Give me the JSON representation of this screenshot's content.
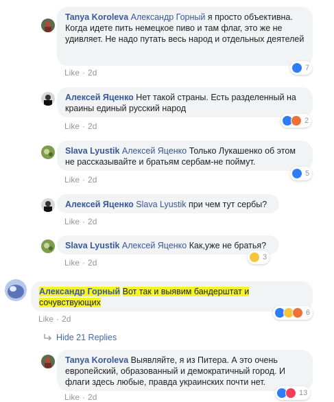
{
  "colors": {
    "link": "#385898",
    "bubble": "#f2f3f5",
    "meta": "#90949c",
    "highlight": "#f7f51f"
  },
  "comments": [
    {
      "author": "Tanya Koroleva",
      "mention": "Александр Горный",
      "text": "я просто объективна. Когда идете пить немецкое пиво и там флаг, это же не удивляет. Не надо путать весь народ и отдельных деятелей",
      "like": "Like",
      "time": "2d",
      "reaction_count": "7"
    },
    {
      "author": "Алексей Яценко",
      "mention": "",
      "text": "Нет такой страны. Есть разделенный на краины единый русский народ",
      "like": "Like",
      "time": "2d",
      "reaction_count": "2"
    },
    {
      "author": "Slava Lyustik",
      "mention": "Алексей Яценко",
      "text": "Только Лукашенко об этом не рассказывайте и братьям сербам-не поймут.",
      "like": "Like",
      "time": "2d",
      "reaction_count": "5"
    },
    {
      "author": "Алексей Яценко",
      "mention": "Slava Lyustik",
      "text": "при чем тут сербы?",
      "like": "Like",
      "time": "2d",
      "reaction_count": ""
    },
    {
      "author": "Slava Lyustik",
      "mention": "Алексей Яценко",
      "text": "Как,уже не братья?",
      "like": "Like",
      "time": "2d",
      "reaction_count": "3"
    },
    {
      "author": "Александр Горный",
      "mention": "",
      "text_line1": "Вот так и выявим бандерштат и",
      "text_line2": "сочувствующих",
      "like": "Like",
      "time": "2d",
      "reaction_count": "6"
    },
    {
      "author": "Tanya Koroleva",
      "mention": "",
      "text": "Выявляйте, я из Питера. А это очень европейский, образованный и демократичный город. И флаги здесь любые, правда украинских почти нет.",
      "like": "Like",
      "time": "2d",
      "reaction_count": "13"
    }
  ],
  "hide_replies": "Hide 21 Replies",
  "icons": {
    "like": "thumbs-up-icon",
    "angry": "angry-face-icon",
    "haha": "laughing-face-icon",
    "sad": "sad-face-icon",
    "love": "heart-icon",
    "reply_arrow": "reply-arrow-icon"
  }
}
